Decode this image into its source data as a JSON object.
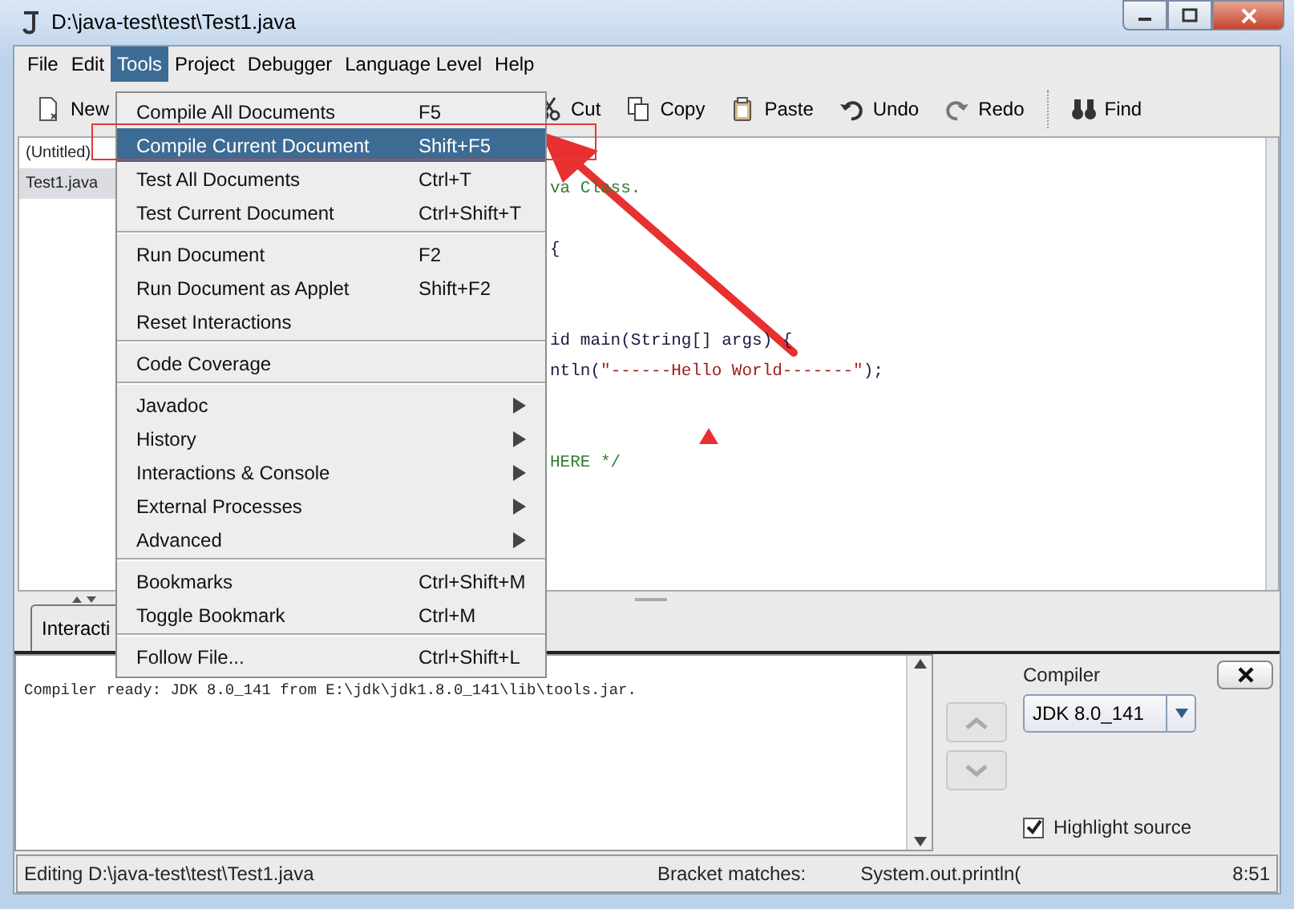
{
  "window": {
    "title": "D:\\java-test\\test\\Test1.java"
  },
  "menu_bar": [
    {
      "label": "File",
      "selected": false
    },
    {
      "label": "Edit",
      "selected": false
    },
    {
      "label": "Tools",
      "selected": true
    },
    {
      "label": "Project",
      "selected": false
    },
    {
      "label": "Debugger",
      "selected": false
    },
    {
      "label": "Language Level",
      "selected": false
    },
    {
      "label": "Help",
      "selected": false
    }
  ],
  "toolbar": {
    "left": [
      {
        "label": "New"
      }
    ],
    "right": [
      {
        "label": "Cut"
      },
      {
        "label": "Copy"
      },
      {
        "label": "Paste"
      },
      {
        "label": "Undo"
      },
      {
        "label": "Redo"
      },
      {
        "label": "Find"
      }
    ]
  },
  "documents": [
    {
      "name": "(Untitled)",
      "selected": false
    },
    {
      "name": "Test1.java",
      "selected": true
    }
  ],
  "editor": {
    "lines": [
      {
        "kind": "code",
        "segments": [
          {
            "text": "va Class.",
            "kind": "comment"
          }
        ]
      },
      {
        "kind": "blank"
      },
      {
        "kind": "code",
        "segments": [
          {
            "text": "{",
            "kind": "plain"
          }
        ]
      },
      {
        "kind": "blank"
      },
      {
        "kind": "blank"
      },
      {
        "kind": "code",
        "segments": [
          {
            "text": "id main(String[] args) {",
            "kind": "plain"
          }
        ]
      },
      {
        "kind": "code",
        "segments": [
          {
            "text": "ntln(",
            "kind": "plain"
          },
          {
            "text": "\"------Hello World-------\"",
            "kind": "string"
          },
          {
            "text": ");",
            "kind": "plain"
          }
        ]
      },
      {
        "kind": "blank"
      },
      {
        "kind": "blank"
      },
      {
        "kind": "code",
        "segments": [
          {
            "text": "HERE */",
            "kind": "comment"
          }
        ]
      }
    ]
  },
  "tabs": [
    {
      "label": "Interacti",
      "selected": true
    }
  ],
  "console": {
    "text": "Compiler ready: JDK 8.0_141 from E:\\jdk\\jdk1.8.0_141\\lib\\tools.jar."
  },
  "compiler_panel": {
    "label": "Compiler",
    "value": "JDK 8.0_141",
    "highlight_source": {
      "label": "Highlight source",
      "checked": true
    }
  },
  "status_bar": {
    "editing": "Editing D:\\java-test\\test\\Test1.java",
    "bracket_label": "Bracket matches:",
    "bracket_value": "System.out.println(",
    "position": "8:51"
  },
  "tools_menu": [
    {
      "kind": "item",
      "label": "Compile All Documents",
      "shortcut": "F5",
      "selected": false
    },
    {
      "kind": "item",
      "label": "Compile Current Document",
      "shortcut": "Shift+F5",
      "selected": true
    },
    {
      "kind": "item",
      "label": "Test All Documents",
      "shortcut": "Ctrl+T",
      "selected": false
    },
    {
      "kind": "item",
      "label": "Test Current Document",
      "shortcut": "Ctrl+Shift+T",
      "selected": false
    },
    {
      "kind": "separator"
    },
    {
      "kind": "item",
      "label": "Run Document",
      "shortcut": "F2",
      "selected": false
    },
    {
      "kind": "item",
      "label": "Run Document as Applet",
      "shortcut": "Shift+F2",
      "selected": false
    },
    {
      "kind": "item",
      "label": "Reset Interactions",
      "selected": false
    },
    {
      "kind": "separator"
    },
    {
      "kind": "item",
      "label": "Code Coverage",
      "selected": false
    },
    {
      "kind": "separator"
    },
    {
      "kind": "submenu",
      "label": "Javadoc",
      "selected": false
    },
    {
      "kind": "submenu",
      "label": "History",
      "selected": false
    },
    {
      "kind": "submenu",
      "label": "Interactions & Console",
      "selected": false
    },
    {
      "kind": "submenu",
      "label": "External Processes",
      "selected": false
    },
    {
      "kind": "submenu",
      "label": "Advanced",
      "selected": false
    },
    {
      "kind": "separator"
    },
    {
      "kind": "item",
      "label": "Bookmarks",
      "shortcut": "Ctrl+Shift+M",
      "selected": false
    },
    {
      "kind": "item",
      "label": "Toggle Bookmark",
      "shortcut": "Ctrl+M",
      "selected": false
    },
    {
      "kind": "separator"
    },
    {
      "kind": "item",
      "label": "Follow File...",
      "shortcut": "Ctrl+Shift+L",
      "selected": false
    }
  ]
}
